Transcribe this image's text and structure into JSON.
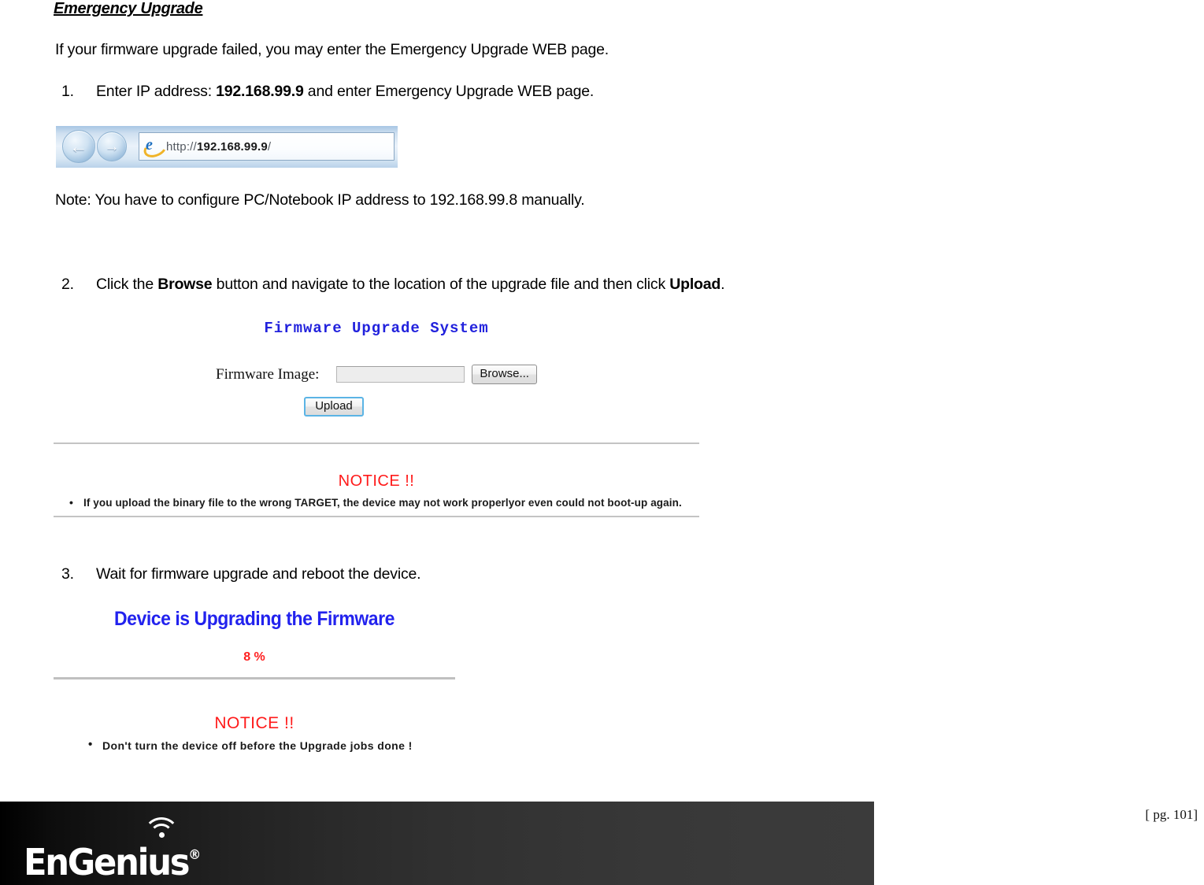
{
  "document": {
    "heading": "Emergency Upgrade",
    "intro": "If your firmware upgrade failed, you may enter the Emergency Upgrade WEB page.",
    "note": "Note: You have to configure PC/Notebook IP address to 192.168.99.8 manually.",
    "steps": [
      {
        "number": "1.",
        "text_before": "Enter IP address: ",
        "bold": "192.168.99.9",
        "text_after": " and enter Emergency Upgrade WEB page."
      },
      {
        "number": "2.",
        "text_before": "Click the ",
        "bold": "Browse",
        "text_mid": " button and navigate to the location of the upgrade file and then click ",
        "bold2": "Upload",
        "text_after": "."
      },
      {
        "number": "3.",
        "text_before": "Wait for firmware upgrade and reboot the device."
      }
    ]
  },
  "browser": {
    "back_label": "←",
    "forward_label": "→",
    "url_scheme": "http://",
    "url_host": "192.168.99.9",
    "url_path": "/"
  },
  "firmware_panel": {
    "title": "Firmware Upgrade System",
    "field_label": "Firmware Image:",
    "field_value": "",
    "field_placeholder": "",
    "browse_label": "Browse...",
    "upload_label": "Upload",
    "notice_title": "NOTICE !!",
    "notice_items": [
      "If you upload the binary file to the wrong TARGET, the device may not work properlyor even could not boot-up again."
    ]
  },
  "upgrade_panel": {
    "title": "Device is Upgrading the Firmware",
    "percent": "8 %",
    "percent_value": 8,
    "notice_title": "NOTICE !!",
    "notice_items": [
      "Don't turn the device off before the Upgrade jobs done !"
    ]
  },
  "footer": {
    "brand": "EnGenius",
    "registered_mark": "®",
    "page_label": "[ pg. 101]"
  },
  "colors": {
    "heading_blue": "#2222dd",
    "notice_red": "#ff1a1a",
    "footer_dark": "#2a2a2a"
  }
}
